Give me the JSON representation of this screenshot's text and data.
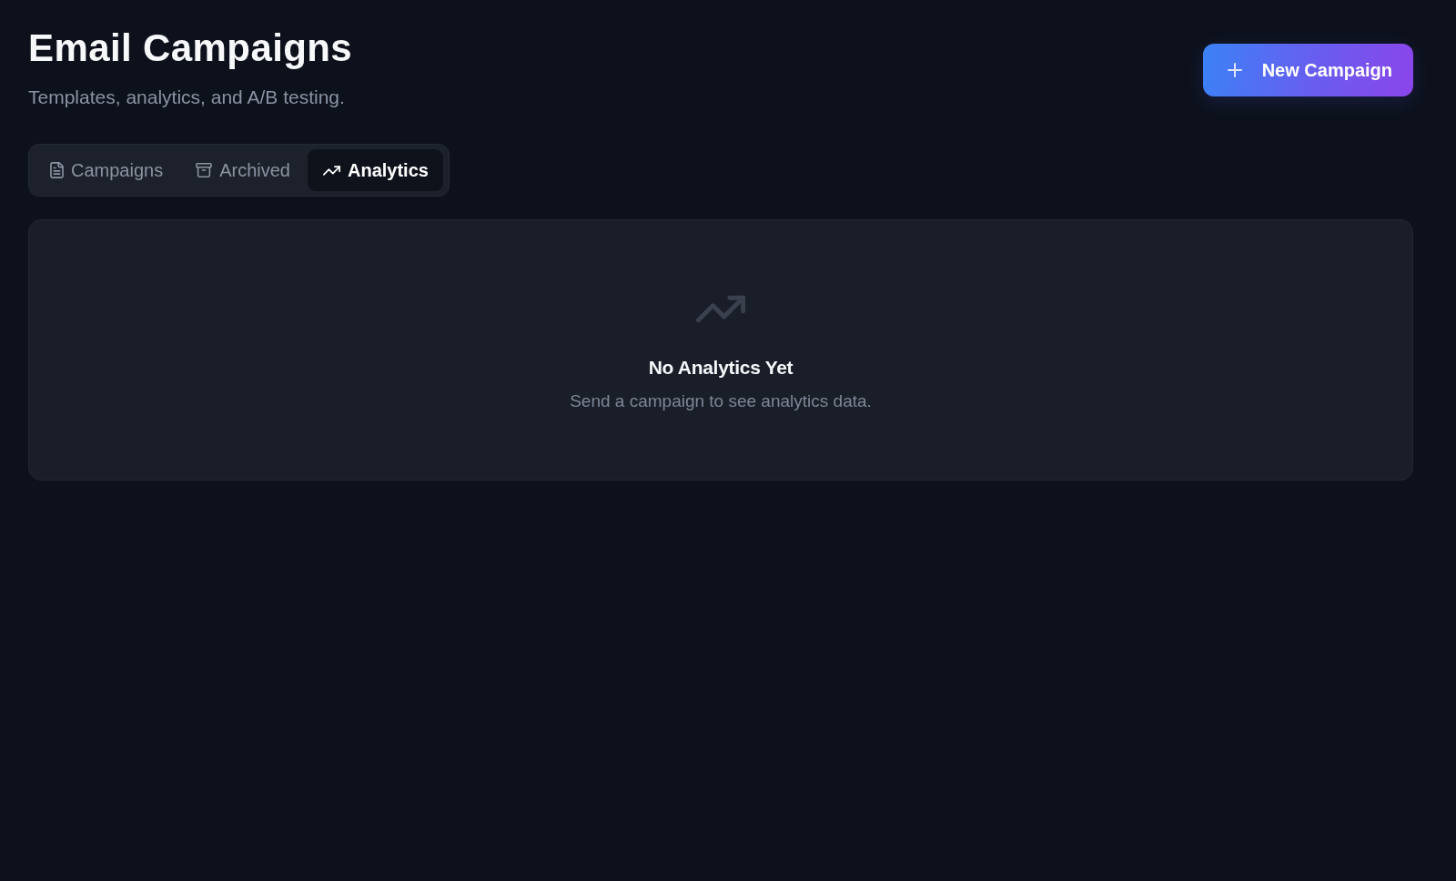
{
  "header": {
    "title": "Email Campaigns",
    "subtitle": "Templates, analytics, and A/B testing."
  },
  "new_button": {
    "label": "New Campaign"
  },
  "tabs": [
    {
      "label": "Campaigns",
      "selected": false
    },
    {
      "label": "Archived",
      "selected": false
    },
    {
      "label": "Analytics",
      "selected": true
    }
  ],
  "empty_state": {
    "title": "No Analytics Yet",
    "message": "Send a campaign to see analytics data."
  }
}
